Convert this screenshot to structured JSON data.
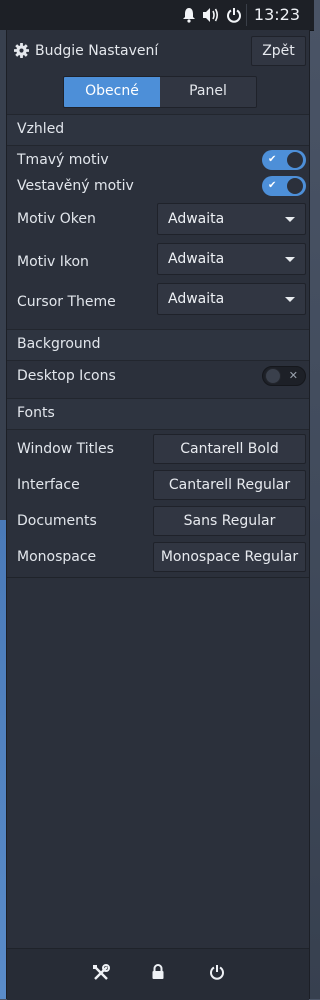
{
  "topbar": {
    "clock": "13:23",
    "tray_icons": [
      "bell-icon",
      "volume-icon",
      "power-icon"
    ]
  },
  "header": {
    "title": "Budgie Nastavení",
    "back_label": "Zpět",
    "icon": "gear-icon"
  },
  "tabs": [
    {
      "label": "Obecné",
      "active": true
    },
    {
      "label": "Panel",
      "active": false
    }
  ],
  "appearance": {
    "heading": "Vzhled",
    "dark_theme": {
      "label": "Tmavý motiv",
      "on": true
    },
    "builtin_theme": {
      "label": "Vestavěný motiv",
      "on": true
    },
    "window_theme": {
      "label": "Motiv Oken",
      "value": "Adwaita"
    },
    "icon_theme": {
      "label": "Motiv Ikon",
      "value": "Adwaita"
    },
    "cursor_theme": {
      "label": "Cursor Theme",
      "value": "Adwaita"
    }
  },
  "background": {
    "heading": "Background",
    "desktop_icons": {
      "label": "Desktop Icons",
      "on": false
    }
  },
  "fonts": {
    "heading": "Fonts",
    "window_titles": {
      "label": "Window Titles",
      "value": "Cantarell Bold"
    },
    "interface": {
      "label": "Interface",
      "value": "Cantarell Regular"
    },
    "documents": {
      "label": "Documents",
      "value": "Sans Regular"
    },
    "monospace": {
      "label": "Monospace",
      "value": "Monospace Regular"
    }
  },
  "footer": {
    "icons": [
      "tools-icon",
      "lock-icon",
      "power-icon"
    ]
  },
  "colors": {
    "accent": "#4d8fd8",
    "panel_bg": "#2b303b",
    "topbar_bg": "#1d2026"
  }
}
